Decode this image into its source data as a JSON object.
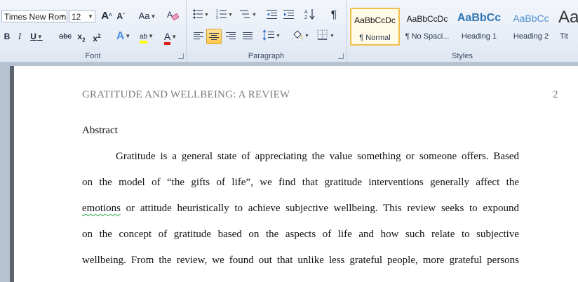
{
  "ribbon": {
    "font_group": {
      "label": "Font",
      "font_name": "Times New Rom",
      "font_size": "12",
      "grow_font": "A",
      "shrink_font": "A",
      "change_case": "Aa",
      "bold": "B",
      "italic": "I",
      "underline": "U",
      "strikethrough": "abc",
      "subscript": "x",
      "superscript": "x",
      "text_effects": "A",
      "highlight": "ab",
      "font_color": "A"
    },
    "paragraph_group": {
      "label": "Paragraph",
      "show_marks": "¶"
    },
    "styles_group": {
      "label": "Styles",
      "styles": [
        {
          "sample": "AaBbCcDc",
          "name": "¶ Normal",
          "active": true
        },
        {
          "sample": "AaBbCcDc",
          "name": "¶ No Spaci...",
          "active": false
        },
        {
          "sample": "AaBbCc",
          "name": "Heading 1",
          "active": false
        },
        {
          "sample": "AaBbCc",
          "name": "Heading 2",
          "active": false
        },
        {
          "sample": "Aa",
          "name": "Tit",
          "active": false
        }
      ]
    }
  },
  "document": {
    "header_title": "GRATITUDE AND WELLBEING: A REVIEW",
    "page_number": "2",
    "abstract_heading": "Abstract",
    "paragraph_lines": [
      "Gratitude is a general state of appreciating the value something or someone offers. Based",
      "on the model of “the gifts of life”, we find that gratitude interventions generally affect the",
      "emotions or attitude heuristically to achieve subjective wellbeing. This review seeks to expound",
      "on the concept of gratitude based on the aspects of life and how such relate to subjective",
      "wellbeing. From the review, we found out that unlike less grateful people, more grateful persons"
    ],
    "flagged_word": "emotions"
  },
  "colors": {
    "ribbon_bg": "#e6ecf5",
    "selected_button": "#ffc74d",
    "heading_blue": "#2e74b5",
    "highlight_yellow": "#ffff00",
    "font_color_red": "#e0201b",
    "grammar_squiggle": "#2fa84a"
  }
}
